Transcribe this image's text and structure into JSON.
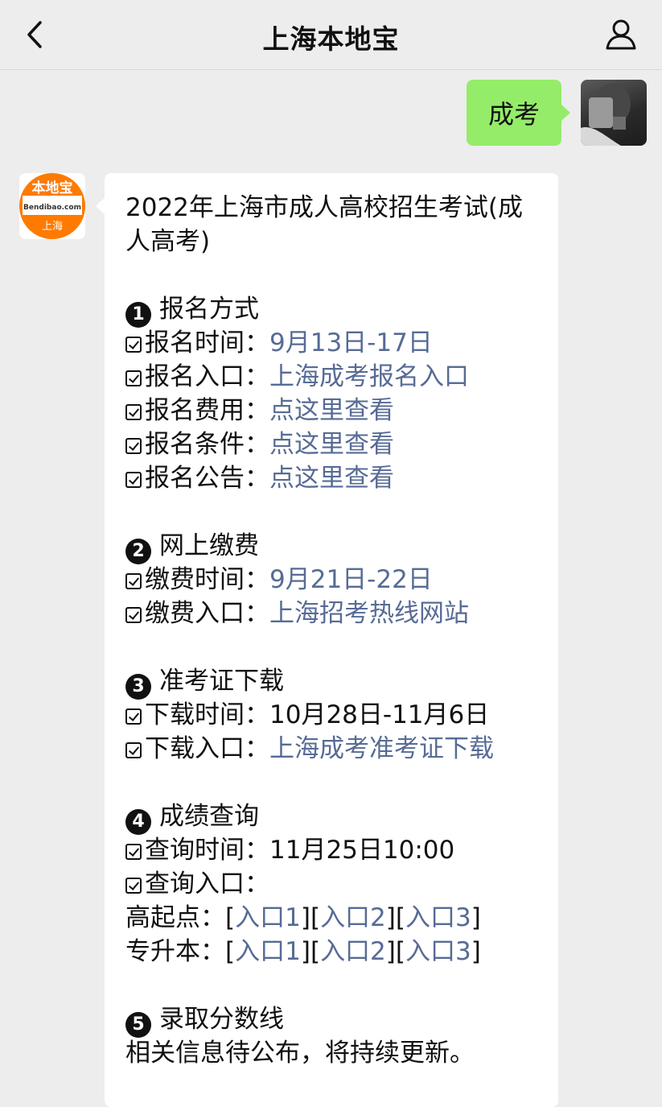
{
  "header": {
    "title": "上海本地宝",
    "back_icon": "chevron-left-icon",
    "profile_icon": "user-icon"
  },
  "outgoing": {
    "text": "成考"
  },
  "bot_avatar": {
    "brand": "本地宝",
    "domain": "Bendibao.com",
    "city": "上海"
  },
  "message": {
    "title": "2022年上海市成人高校招生考试(成人高考)",
    "sections": [
      {
        "num": "1",
        "heading": "报名方式",
        "rows": [
          {
            "label": "报名时间：",
            "value": "9月13日-17日",
            "link": true
          },
          {
            "label": "报名入口：",
            "value": "上海成考报名入口",
            "link": true
          },
          {
            "label": "报名费用：",
            "value": "点这里查看",
            "link": true
          },
          {
            "label": "报名条件：",
            "value": "点这里查看",
            "link": true
          },
          {
            "label": "报名公告：",
            "value": "点这里查看",
            "link": true
          }
        ]
      },
      {
        "num": "2",
        "heading": "网上缴费",
        "rows": [
          {
            "label": "缴费时间：",
            "value": "9月21日-22日",
            "link": true
          },
          {
            "label": "缴费入口：",
            "value": "上海招考热线网站",
            "link": true
          }
        ]
      },
      {
        "num": "3",
        "heading": "准考证下载",
        "rows": [
          {
            "label": "下载时间：",
            "value": "10月28日-11月6日",
            "link": false
          },
          {
            "label": "下载入口：",
            "value": "上海成考准考证下载",
            "link": true
          }
        ]
      },
      {
        "num": "4",
        "heading": "成绩查询",
        "rows": [
          {
            "label": "查询时间：",
            "value": "11月25日10:00",
            "link": false
          },
          {
            "label": "查询入口：",
            "value": "",
            "link": false
          }
        ],
        "entries": [
          {
            "label": "高起点：",
            "links": [
              "入口1",
              "入口2",
              "入口3"
            ]
          },
          {
            "label": "专升本：",
            "links": [
              "入口1",
              "入口2",
              "入口3"
            ]
          }
        ]
      },
      {
        "num": "5",
        "heading": "录取分数线",
        "note": "相关信息待公布，将持续更新。"
      }
    ]
  },
  "colors": {
    "link": "#576b95",
    "bubble_out": "#95ec69",
    "background": "#ededed"
  }
}
